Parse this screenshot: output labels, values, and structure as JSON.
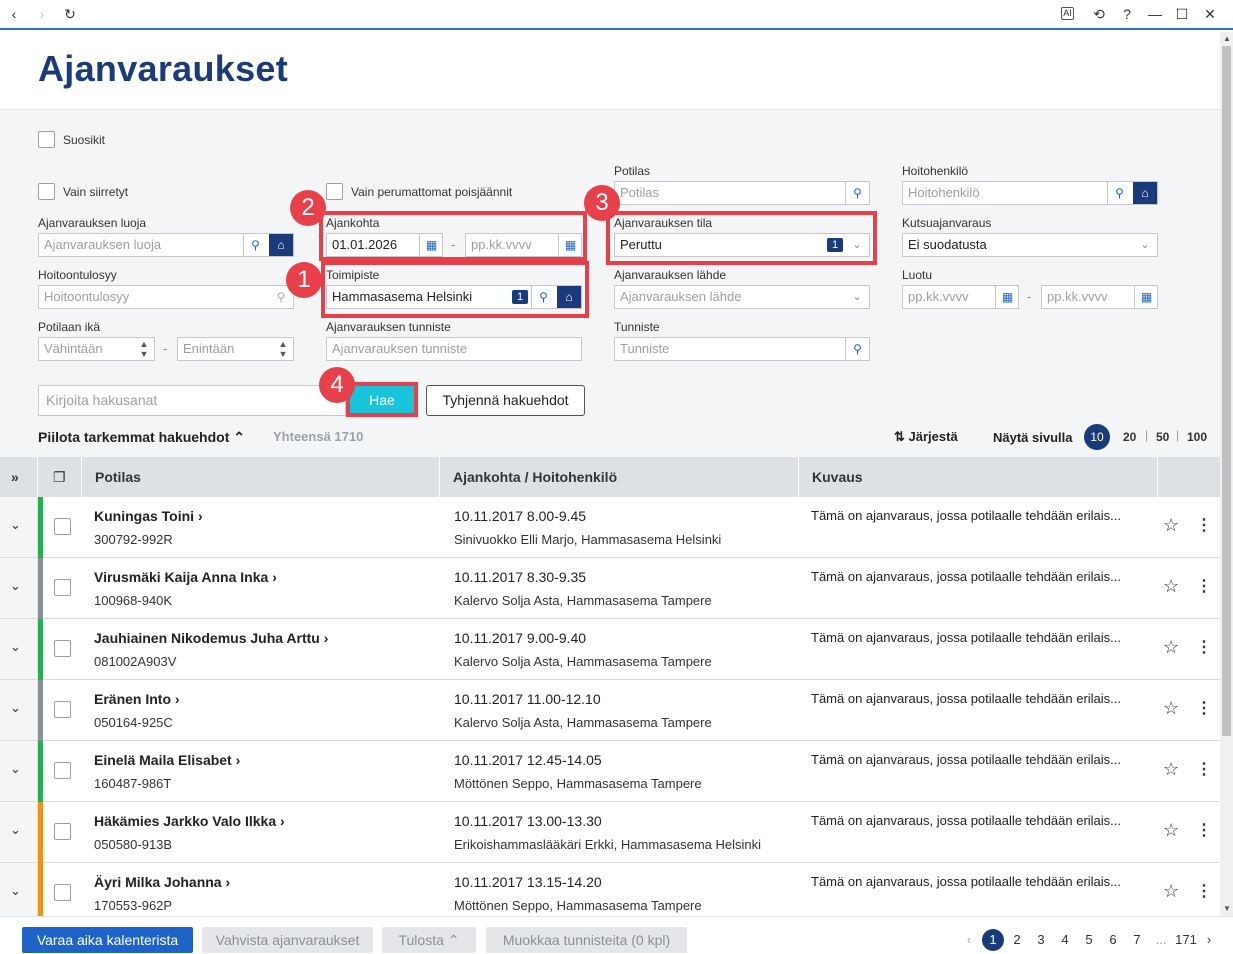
{
  "browser": {
    "back": "‹",
    "forward": "›",
    "reload": "↻",
    "ai": "AI",
    "history": "⟲",
    "help": "?",
    "minimize": "—",
    "maximize": "☐",
    "close": "✕"
  },
  "page": {
    "title": "Ajanvaraukset"
  },
  "filters": {
    "favorites_label": "Suosikit",
    "only_transferred_label": "Vain siirretyt",
    "only_unremoved_cancelled_label": "Vain perumattomat poisjäännit",
    "creator": {
      "label": "Ajanvarauksen luoja",
      "placeholder": "Ajanvarauksen luoja"
    },
    "time": {
      "label": "Ajankohta",
      "from": "01.01.2026",
      "to_placeholder": "pp.kk.vvvv"
    },
    "reason": {
      "label": "Hoitoontulosyy",
      "placeholder": "Hoitoontulosyy"
    },
    "location": {
      "label": "Toimipiste",
      "value": "Hammasasema Helsinki",
      "count": "1"
    },
    "age": {
      "label": "Potilaan ikä",
      "min_placeholder": "Vähintään",
      "max_placeholder": "Enintään"
    },
    "booking_id": {
      "label": "Ajanvarauksen tunniste",
      "placeholder": "Ajanvarauksen tunniste"
    },
    "patient": {
      "label": "Potilas",
      "placeholder": "Potilas"
    },
    "status": {
      "label": "Ajanvarauksen tila",
      "value": "Peruttu",
      "count": "1"
    },
    "source": {
      "label": "Ajanvarauksen lähde",
      "placeholder": "Ajanvarauksen lähde"
    },
    "identifier": {
      "label": "Tunniste",
      "placeholder": "Tunniste"
    },
    "caregiver": {
      "label": "Hoitohenkilö",
      "placeholder": "Hoitohenkilö"
    },
    "invitation": {
      "label": "Kutsuajanvaraus",
      "value": "Ei suodatusta"
    },
    "created": {
      "label": "Luotu",
      "from_placeholder": "pp.kk.vvvv",
      "to_placeholder": "pp.kk.vvvv"
    },
    "search_placeholder": "Kirjoita hakusanat",
    "search_button": "Hae",
    "clear_button": "Tyhjennä hakuehdot",
    "hide_advanced": "Piilota tarkemmat hakuehdot",
    "total": "Yhteensä 1710",
    "sort": "Järjestä",
    "page_size_label": "Näytä sivulla",
    "page_sizes": [
      "10",
      "20",
      "50",
      "100"
    ]
  },
  "annotations": [
    "1",
    "2",
    "3",
    "4"
  ],
  "table": {
    "headers": [
      "Potilas",
      "Ajankohta / Hoitohenkilö",
      "Kuvaus"
    ],
    "rows": [
      {
        "name": "Kuningas Toini",
        "id": "300792-992R",
        "when": "10.11.2017 8.00-9.45",
        "who": "Sinivuokko Elli Marjo, Hammasasema Helsinki",
        "desc": "Tämä on ajanvaraus, jossa potilaalle tehdään erilais...",
        "color": "#22b14c"
      },
      {
        "name": "Virusmäki Kaija Anna Inka",
        "id": "100968-940K",
        "when": "10.11.2017 8.30-9.35",
        "who": "Kalervo Solja Asta, Hammasasema Tampere",
        "desc": "Tämä on ajanvaraus, jossa potilaalle tehdään erilais...",
        "color": "#8a8f96"
      },
      {
        "name": "Jauhiainen Nikodemus Juha Arttu",
        "id": "081002A903V",
        "when": "10.11.2017 9.00-9.40",
        "who": "Kalervo Solja Asta, Hammasasema Tampere",
        "desc": "Tämä on ajanvaraus, jossa potilaalle tehdään erilais...",
        "color": "#22b14c"
      },
      {
        "name": "Eränen Into",
        "id": "050164-925C",
        "when": "10.11.2017 11.00-12.10",
        "who": "Kalervo Solja Asta, Hammasasema Tampere",
        "desc": "Tämä on ajanvaraus, jossa potilaalle tehdään erilais...",
        "color": "#8a8f96"
      },
      {
        "name": "Einelä Maila Elisabet",
        "id": "160487-986T",
        "when": "10.11.2017 12.45-14.05",
        "who": "Möttönen Seppo, Hammasasema Tampere",
        "desc": "Tämä on ajanvaraus, jossa potilaalle tehdään erilais...",
        "color": "#22b14c"
      },
      {
        "name": "Häkämies Jarkko Valo Ilkka",
        "id": "050580-913B",
        "when": "10.11.2017 13.00-13.30",
        "who": "Erikoishammaslääkäri Erkki, Hammasasema Helsinki",
        "desc": "Tämä on ajanvaraus, jossa potilaalle tehdään erilais...",
        "color": "#f39019"
      },
      {
        "name": "Äyri Milka Johanna",
        "id": "170553-962P",
        "when": "10.11.2017 13.15-14.20",
        "who": "Möttönen Seppo, Hammasasema Tampere",
        "desc": "Tämä on ajanvaraus, jossa potilaalle tehdään erilais...",
        "color": "#f39019"
      }
    ]
  },
  "footer": {
    "book_button": "Varaa aika kalenterista",
    "confirm_button": "Vahvista ajanvaraukset",
    "print_button": "Tulosta",
    "edit_ids_button": "Muokkaa tunnisteita (0 kpl)",
    "pages": [
      "1",
      "2",
      "3",
      "4",
      "5",
      "6",
      "7"
    ],
    "ellipsis": "...",
    "last_page": "171"
  }
}
